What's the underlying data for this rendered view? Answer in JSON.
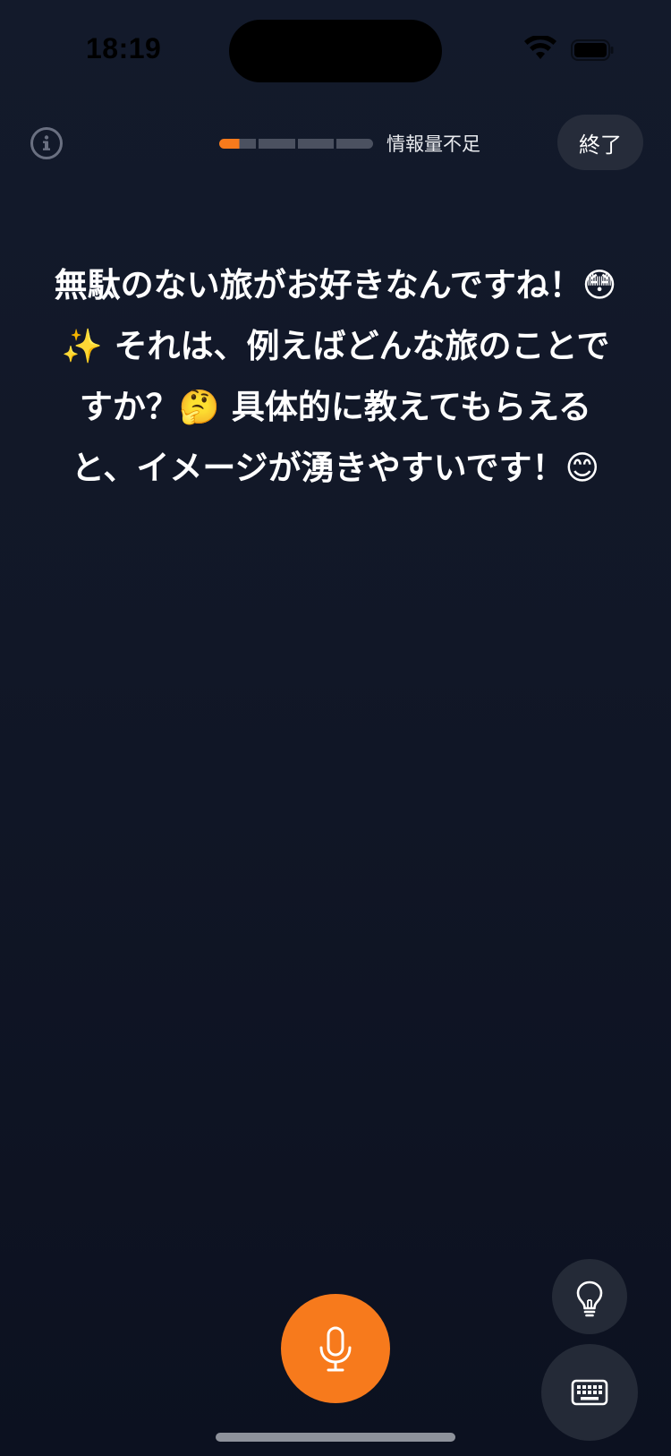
{
  "status_bar": {
    "time": "18:19",
    "wifi_icon": "wifi-icon",
    "battery_icon": "battery-icon"
  },
  "header": {
    "info_icon": "info-icon",
    "progress": {
      "segments": 4,
      "filled_fraction": 0.14,
      "fill_color": "#f77a1c",
      "empty_color": "#4b5160"
    },
    "status_label": "情報量不足",
    "end_button_label": "終了"
  },
  "message": {
    "text": "無駄のない旅がお好きなんですね！😳✨ それは、例えばどんな旅のことですか？🤔 具体的に教えてもらえると、イメージが湧きやすいです！😊"
  },
  "controls": {
    "hint_icon": "lightbulb-icon",
    "keyboard_icon": "keyboard-icon",
    "mic_icon": "microphone-icon",
    "accent_color": "#f77a1c"
  }
}
